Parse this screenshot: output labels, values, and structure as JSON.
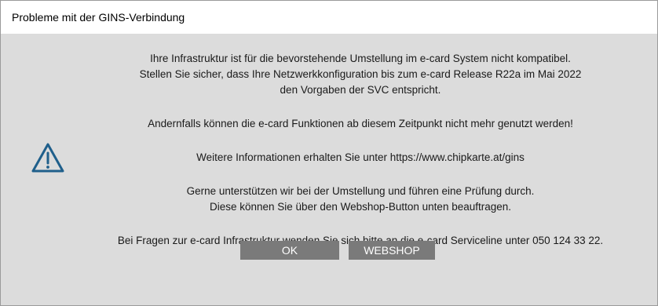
{
  "window": {
    "title": "Probleme mit der GINS-Verbindung"
  },
  "icons": {
    "warning": "warning-triangle-icon"
  },
  "message": {
    "line1": "Ihre Infrastruktur ist für die bevorstehende Umstellung im e-card System nicht kompatibel.",
    "line2": "Stellen Sie sicher, dass Ihre Netzwerkkonfiguration bis zum e-card Release R22a im Mai 2022",
    "line3": "den Vorgaben der SVC entspricht.",
    "line4": "Andernfalls können die e-card Funktionen ab diesem Zeitpunkt nicht mehr genutzt werden!",
    "line5": "Weitere Informationen erhalten Sie unter https://www.chipkarte.at/gins",
    "line6": "Gerne unterstützen wir bei der Umstellung und führen eine Prüfung durch.",
    "line7": "Diese können Sie über den Webshop-Button unten beauftragen.",
    "line8": "Bei Fragen zur e-card Infrastruktur wenden Sie sich bitte an die e-card Serviceline unter 050 124 33 22."
  },
  "buttons": {
    "ok": "OK",
    "webshop": "WEBSHOP"
  },
  "colors": {
    "icon": "#1f5f8b",
    "button_bg": "#7a7a7a",
    "dialog_bg": "#dcdcdc"
  }
}
